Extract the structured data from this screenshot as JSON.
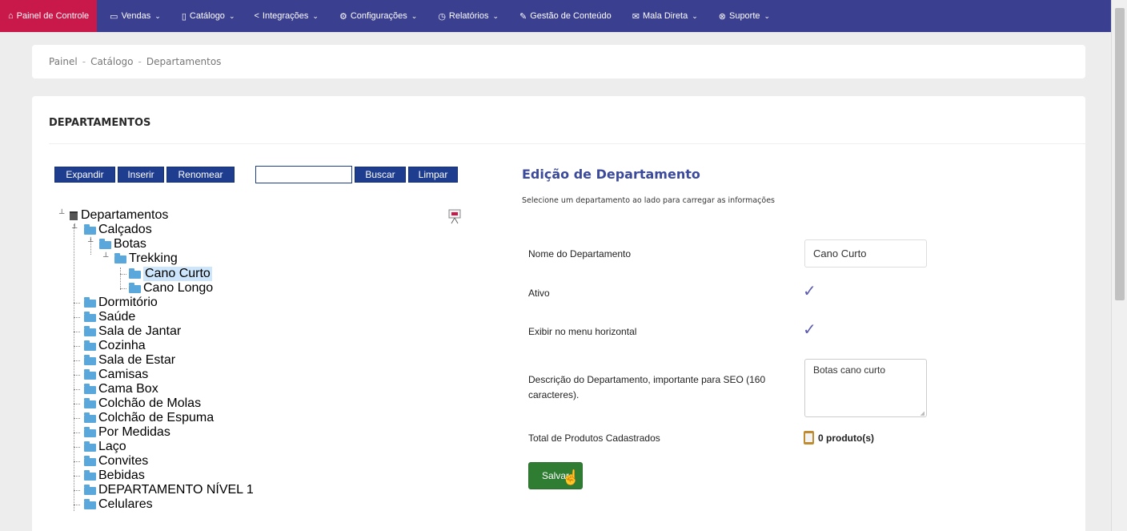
{
  "nav": {
    "items": [
      {
        "label": "Painel de Controle",
        "icon": "home-icon",
        "glyph": "⌂",
        "chevron": false
      },
      {
        "label": "Vendas",
        "icon": "folder-icon",
        "glyph": "▭",
        "chevron": true
      },
      {
        "label": "Catálogo",
        "icon": "book-icon",
        "glyph": "▯",
        "chevron": true
      },
      {
        "label": "Integrações",
        "icon": "share-icon",
        "glyph": "<",
        "chevron": true
      },
      {
        "label": "Configurações",
        "icon": "gear-icon",
        "glyph": "⚙",
        "chevron": true
      },
      {
        "label": "Relatórios",
        "icon": "chart-icon",
        "glyph": "◷",
        "chevron": true
      },
      {
        "label": "Gestão de Conteúdo",
        "icon": "edit-icon",
        "glyph": "✎",
        "chevron": false
      },
      {
        "label": "Mala Direta",
        "icon": "mail-icon",
        "glyph": "✉",
        "chevron": true
      },
      {
        "label": "Suporte",
        "icon": "support-icon",
        "glyph": "⊗",
        "chevron": true
      }
    ]
  },
  "breadcrumb": {
    "items": [
      "Painel",
      "Catálogo",
      "Departamentos"
    ]
  },
  "panel": {
    "title": "DEPARTAMENTOS"
  },
  "toolbar": {
    "expand": "Expandir",
    "insert": "Inserir",
    "rename": "Renomear",
    "search": "Buscar",
    "clear": "Limpar",
    "search_value": ""
  },
  "tree": {
    "root": "Departamentos",
    "calcados": "Calçados",
    "botas": "Botas",
    "trekking": "Trekking",
    "cano_curto": "Cano Curto",
    "cano_longo": "Cano Longo",
    "others": [
      "Dormitório",
      "Saúde",
      "Sala de Jantar",
      "Cozinha",
      "Sala de Estar",
      "Camisas",
      "Cama Box",
      "Colchão de Molas",
      "Colchão de Espuma",
      "Por Medidas",
      "Laço",
      "Convites",
      "Bebidas",
      "DEPARTAMENTO NÍVEL 1",
      "Celulares"
    ]
  },
  "edit": {
    "title": "Edição de Departamento",
    "subtitle": "Selecione um departamento ao lado para carregar as informações",
    "name_label": "Nome do Departamento",
    "name_value": "Cano Curto",
    "active_label": "Ativo",
    "active": true,
    "menu_label": "Exibir no menu horizontal",
    "menu": true,
    "desc_label": "Descrição do Departamento, importante para SEO (160 caracteres).",
    "desc_value": "Botas cano curto",
    "total_label": "Total de Produtos Cadastrados",
    "total_value": "0 produto(s)",
    "save_label": "Salvar"
  },
  "colors": {
    "nav_bg": "#3b3f8f",
    "nav_active": "#c9184a",
    "button_blue": "#1f3d8f",
    "save_green": "#2f7d32",
    "title_blue": "#3b4a9b"
  }
}
